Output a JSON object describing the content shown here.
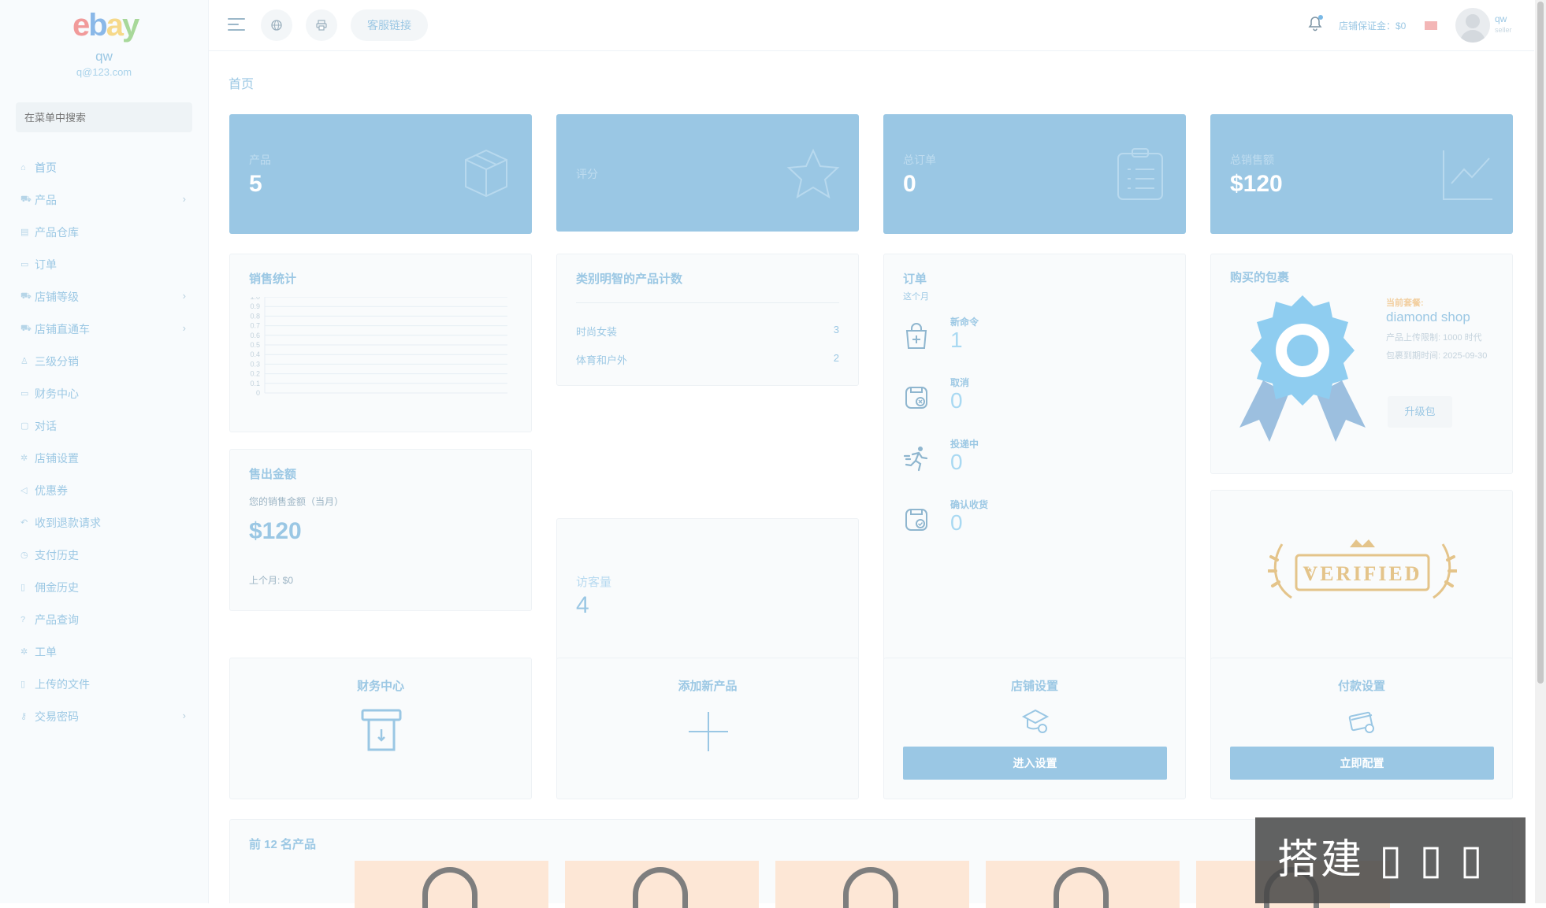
{
  "sidebar": {
    "logo_letters": [
      "e",
      "b",
      "a",
      "y"
    ],
    "user_name": "qw",
    "user_email": "q@123.com",
    "search_placeholder": "在菜单中搜索",
    "items": [
      {
        "label": "首页",
        "icon": "home-icon",
        "has_arrow": false
      },
      {
        "label": "产品",
        "icon": "cart-icon",
        "has_arrow": true
      },
      {
        "label": "产品仓库",
        "icon": "warehouse-icon",
        "has_arrow": false
      },
      {
        "label": "订单",
        "icon": "order-icon",
        "has_arrow": false
      },
      {
        "label": "店铺等级",
        "icon": "cart-icon",
        "has_arrow": true
      },
      {
        "label": "店铺直通车",
        "icon": "cart-icon",
        "has_arrow": true
      },
      {
        "label": "三级分销",
        "icon": "user-icon",
        "has_arrow": false
      },
      {
        "label": "财务中心",
        "icon": "wallet-icon",
        "has_arrow": false
      },
      {
        "label": "对话",
        "icon": "chat-icon",
        "has_arrow": false
      },
      {
        "label": "店铺设置",
        "icon": "gear-icon",
        "has_arrow": false
      },
      {
        "label": "优惠券",
        "icon": "megaphone-icon",
        "has_arrow": false
      },
      {
        "label": "收到退款请求",
        "icon": "refund-icon",
        "has_arrow": false
      },
      {
        "label": "支付历史",
        "icon": "history-icon",
        "has_arrow": false
      },
      {
        "label": "佣金历史",
        "icon": "file-icon",
        "has_arrow": false
      },
      {
        "label": "产品查询",
        "icon": "question-icon",
        "has_arrow": false
      },
      {
        "label": "工单",
        "icon": "gear-icon",
        "has_arrow": false
      },
      {
        "label": "上传的文件",
        "icon": "folder-icon",
        "has_arrow": false
      },
      {
        "label": "交易密码",
        "icon": "key-icon",
        "has_arrow": true
      }
    ]
  },
  "topbar": {
    "customer_service": "客服链接",
    "deposit": "店铺保证金：$0",
    "user_name": "qw",
    "user_role": "seller"
  },
  "breadcrumb": "首页",
  "stats": [
    {
      "label": "产品",
      "value": "5",
      "icon": "box-icon"
    },
    {
      "label": "评分",
      "value": "",
      "icon": "star-icon"
    },
    {
      "label": "总订单",
      "value": "0",
      "icon": "clipboard-icon"
    },
    {
      "label": "总销售额",
      "value": "$120",
      "icon": "chart-line-icon"
    }
  ],
  "sales_stats": {
    "title": "销售统计",
    "chart_data": {
      "type": "line",
      "title": "销售统计",
      "y_ticks": [
        "1.0",
        "0.9",
        "0.8",
        "0.7",
        "0.6",
        "0.5",
        "0.4",
        "0.3",
        "0.2",
        "0.1",
        "0"
      ],
      "ylim": [
        0,
        1
      ],
      "grid": true,
      "series": []
    }
  },
  "categories": {
    "title": "类别明智的产品计数",
    "rows": [
      {
        "name": "时尚女装",
        "count": "3"
      },
      {
        "name": "体育和户外",
        "count": "2"
      }
    ]
  },
  "orders": {
    "title": "订单",
    "subtitle": "这个月",
    "items": [
      {
        "label": "新命令",
        "value": "1",
        "icon": "bag-plus-icon"
      },
      {
        "label": "取消",
        "value": "0",
        "icon": "cancel-icon"
      },
      {
        "label": "投递中",
        "value": "0",
        "icon": "runner-icon"
      },
      {
        "label": "确认收货",
        "value": "0",
        "icon": "check-box-icon"
      }
    ]
  },
  "package": {
    "title": "购买的包裹",
    "current_label": "当前套餐:",
    "name": "diamond shop",
    "upload_limit": "产品上传限制: 1000 时代",
    "expiry": "包裹到期时间: 2025-09-30",
    "upgrade_button": "升级包"
  },
  "verified": {
    "badge_text": "VERIFIED"
  },
  "sold_amount": {
    "title": "售出金额",
    "subtitle": "您的销售金额（当月）",
    "value": "$120",
    "last_month": "上个月: $0"
  },
  "visitors": {
    "label": "访客量",
    "value": "4"
  },
  "actions": [
    {
      "title": "财务中心",
      "icon": "withdraw-icon",
      "button": ""
    },
    {
      "title": "添加新产品",
      "icon": "plus-icon",
      "button": ""
    },
    {
      "title": "店铺设置",
      "icon": "shop-gear-icon",
      "button": "进入设置"
    },
    {
      "title": "付款设置",
      "icon": "card-gear-icon",
      "button": "立即配置"
    }
  ],
  "top_products": {
    "title": "前 12 名产品",
    "count_visible": 5
  },
  "watermark": "搭建",
  "colors": {
    "accent": "#9ac7e4",
    "text": "#9cc8e4",
    "badge_blue": "#8fcdf0",
    "gold": "#e4c48a"
  }
}
